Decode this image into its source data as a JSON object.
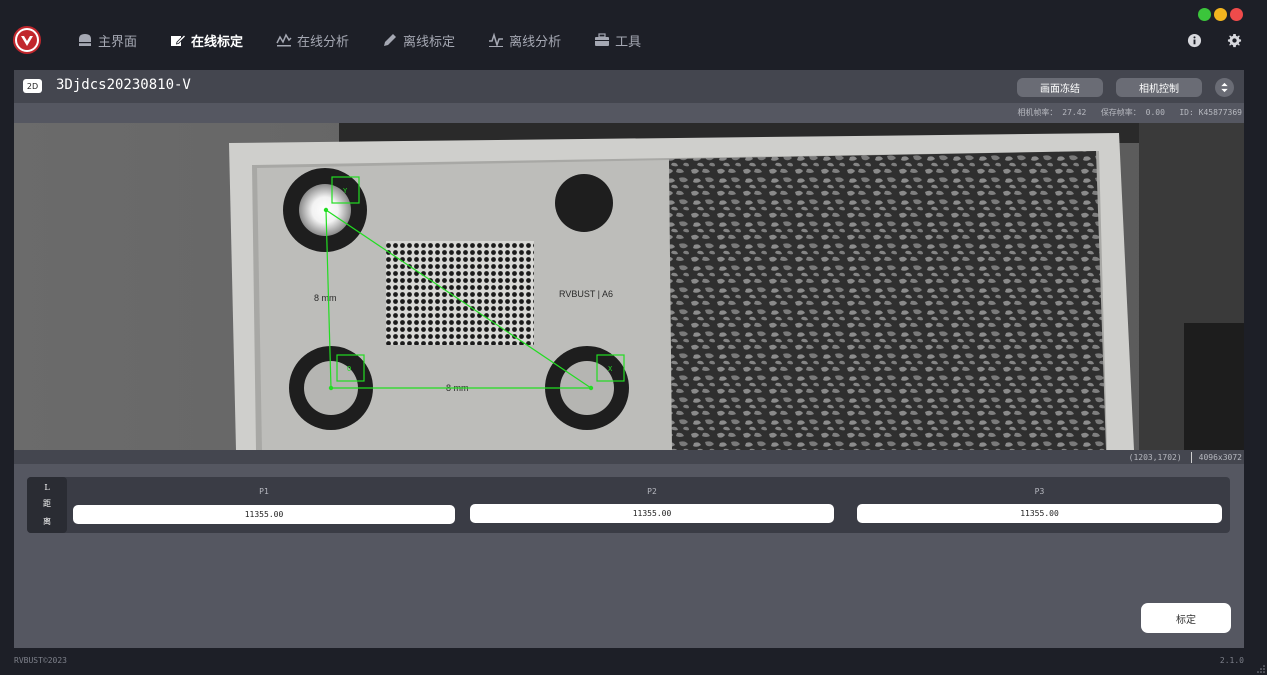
{
  "nav": [
    {
      "label": "主界面",
      "icon": "home-icon",
      "active": false
    },
    {
      "label": "在线标定",
      "icon": "edit-icon",
      "active": true
    },
    {
      "label": "在线分析",
      "icon": "analysis-icon",
      "active": false
    },
    {
      "label": "离线标定",
      "icon": "pen-icon",
      "active": false
    },
    {
      "label": "离线分析",
      "icon": "wave-icon",
      "active": false
    },
    {
      "label": "工具",
      "icon": "toolbox-icon",
      "active": false
    }
  ],
  "window_controls": {
    "colors": [
      "#3bc53b",
      "#f2b51f",
      "#ef4b4b"
    ]
  },
  "header": {
    "badge": "2D",
    "camera_title": "3Djdcs20230810-V",
    "freeze_label": "画面冻结",
    "camera_control_label": "相机控制"
  },
  "stats": {
    "camera_fps_label": "相机帧率：",
    "camera_fps": "27.42",
    "save_fps_label": "保存帧率：",
    "save_fps": "0.00",
    "id_label": "ID:",
    "id": "K45877369"
  },
  "viewer": {
    "target_text": "RVBUST | A6",
    "dim_vertical": "8 mm",
    "dim_horizontal": "8 mm",
    "marker_labels": [
      "Y",
      "O",
      "X"
    ],
    "cursor": "(1203,1702)",
    "resolution": "4096x3072"
  },
  "distance": {
    "label_chars": [
      "L",
      "距",
      "离"
    ],
    "fields": [
      {
        "label": "P1",
        "value": "11355.00"
      },
      {
        "label": "P2",
        "value": "11355.00"
      },
      {
        "label": "P3",
        "value": "11355.00"
      }
    ]
  },
  "calibrate_label": "标定",
  "footer": {
    "copyright": "RVBUST©2023",
    "version": "2.1.0"
  },
  "colors": {
    "accent_green": "#22dd22",
    "logo_red": "#c1272d",
    "panel": "#555761"
  }
}
